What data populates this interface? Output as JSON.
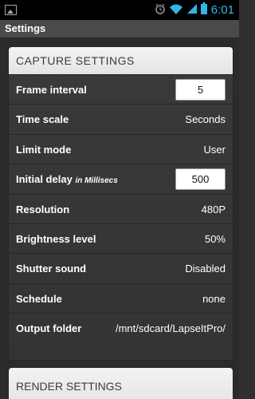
{
  "status_bar": {
    "time": "6:01",
    "icons": [
      "image-icon",
      "alarm-icon",
      "wifi-icon",
      "signal-icon",
      "battery-icon"
    ]
  },
  "app": {
    "title": "Settings"
  },
  "capture": {
    "header": "CAPTURE SETTINGS",
    "rows": [
      {
        "label": "Frame interval",
        "value": "5",
        "kind": "input"
      },
      {
        "label": "Time scale",
        "value": "Seconds",
        "kind": "text"
      },
      {
        "label": "Limit mode",
        "value": "User",
        "kind": "text"
      },
      {
        "label": "Initial delay",
        "sublabel": "in Millisecs",
        "value": "500",
        "kind": "input"
      },
      {
        "label": "Resolution",
        "value": "480P",
        "kind": "text"
      },
      {
        "label": "Brightness level",
        "value": "50%",
        "kind": "text"
      },
      {
        "label": "Shutter sound",
        "value": "Disabled",
        "kind": "text"
      },
      {
        "label": "Schedule",
        "value": "none",
        "kind": "text"
      },
      {
        "label": "Output folder",
        "value": "/mnt/sdcard/LapseItPro/",
        "kind": "text"
      }
    ]
  },
  "render": {
    "header": "RENDER SETTINGS"
  },
  "colors": {
    "clock": "#33b5e5",
    "background": "#2b2b2b"
  }
}
